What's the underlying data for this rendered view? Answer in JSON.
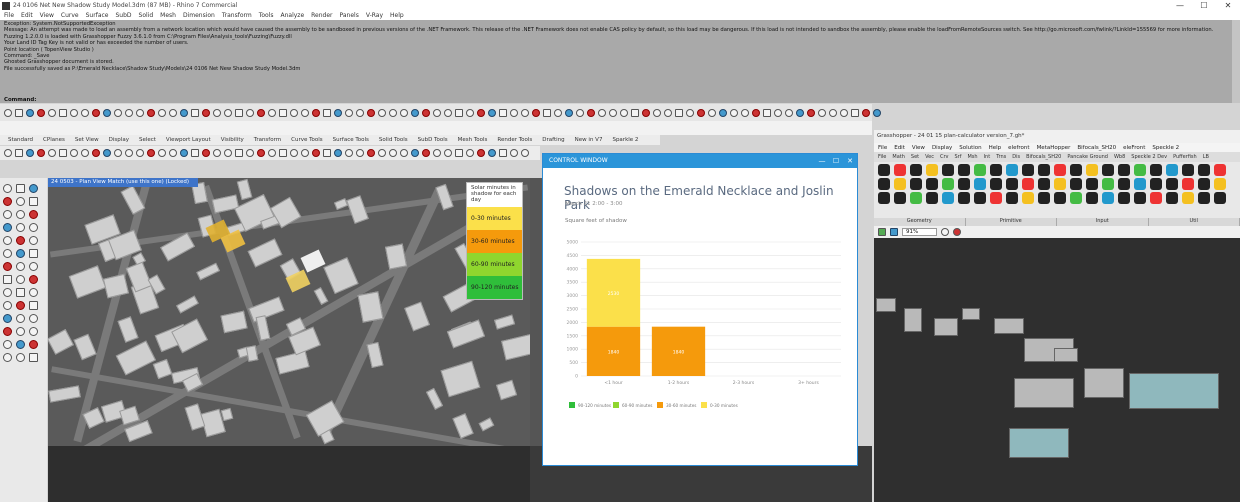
{
  "window": {
    "title": "24 0106 Net New Shadow Study Model.3dm (87 MB) - Rhino 7 Commercial",
    "controls": [
      "—",
      "☐",
      "✕"
    ]
  },
  "menubar": [
    "File",
    "Edit",
    "View",
    "Curve",
    "Surface",
    "SubD",
    "Solid",
    "Mesh",
    "Dimension",
    "Transform",
    "Tools",
    "Analyze",
    "Render",
    "Panels",
    "V-Ray",
    "Help"
  ],
  "command_history": [
    "Exception: System.NotSupportedException",
    "Message: An attempt was made to load an assembly from a network location which would have caused the assembly to be sandboxed in previous versions of the .NET Framework. This release of the .NET Framework does not enable CAS policy by default, so this load may be dangerous. If this load is not intended to sandbox the assembly, please enable the loadFromRemoteSources switch. See http://go.microsoft.com/fwlink/?LinkId=155569 for more information.",
    "",
    "Fuzzing 1.2.0.0 is loaded with Grasshopper Fuzzy 3.6.1.0 from C:\\Program Files\\Analysis_tools\\Fuzzing\\Fuzzy.dll",
    "Your Land ID Tag Key is not valid or has exceeded the number of users.",
    "Point location ( TopenView Studio )",
    "Command: _Save",
    "Ghosted Grasshopper document is stored.",
    "File successfully saved as P:\\Emerald Necklace\\Shadow Study\\Models\\24 0106 Net New Shadow Study Model.3dm"
  ],
  "command_prompt": "Command:",
  "toolbar_tabs": [
    "Standard",
    "CPlanes",
    "Set View",
    "Display",
    "Select",
    "Viewport Layout",
    "Visibility",
    "Transform",
    "Curve Tools",
    "Surface Tools",
    "Solid Tools",
    "SubD Tools",
    "Mesh Tools",
    "Render Tools",
    "Drafting",
    "New in V7",
    "Sparkle 2"
  ],
  "viewport": {
    "label": "24 0503 - Plan View Match (use this one) (Locked)"
  },
  "legend": {
    "header": "Solar minutes in shadow for each day",
    "items": [
      {
        "label": "0-30 minutes",
        "color": "#fbe04a"
      },
      {
        "label": "30-60 minutes",
        "color": "#f59a0c"
      },
      {
        "label": "60-90 minutes",
        "color": "#8fd62e"
      },
      {
        "label": "90-120 minutes",
        "color": "#2fbe3a"
      }
    ]
  },
  "control_window": {
    "title": "CONTROL WINDOW",
    "controls": [
      "—",
      "☐",
      "✕"
    ],
    "chart_title": "Shadows on the Emerald Necklace and Joslin Park",
    "chart_subtitle": "March 21 2:00 - 3:00",
    "y_label": "Square feet of shadow"
  },
  "chart_data": {
    "type": "bar",
    "stacked": true,
    "categories": [
      "<1 hour",
      "1-2 hours",
      "2-3 hours",
      "3+ hours"
    ],
    "ylim": [
      0,
      5000
    ],
    "ytick_labels": [
      "5000",
      "4500",
      "4000",
      "3500",
      "3000",
      "2500",
      "2000",
      "1500",
      "1000",
      "500",
      "0"
    ],
    "series": [
      {
        "name": "90-120 minutes",
        "color": "#2fbe3a",
        "values": [
          0,
          0,
          0,
          0
        ]
      },
      {
        "name": "60-90 minutes",
        "color": "#8fd62e",
        "values": [
          0,
          0,
          0,
          0
        ]
      },
      {
        "name": "30-60 minutes",
        "color": "#f59a0c",
        "values": [
          1840,
          1840,
          0,
          0
        ]
      },
      {
        "name": "0-30 minutes",
        "color": "#fbe04a",
        "values": [
          2530,
          0,
          0,
          0
        ]
      }
    ],
    "data_labels": [
      {
        "category": 0,
        "series": 2,
        "text": "1840"
      },
      {
        "category": 0,
        "series": 3,
        "text": "2530"
      },
      {
        "category": 1,
        "series": 2,
        "text": "1840"
      }
    ],
    "grid": true,
    "legend_position": "bottom-left"
  },
  "grasshopper": {
    "title": "Grasshopper - 24 01 15 plan-calculator version_7.gh*",
    "menu": [
      "File",
      "Edit",
      "View",
      "Display",
      "Solution",
      "Help",
      "elefront",
      "MetaHopper",
      "Bifocals_SH20",
      "eleFront",
      "Speckle 2"
    ],
    "tabs": [
      "File",
      "Math",
      "Set",
      "Vec",
      "Crv",
      "Srf",
      "Msh",
      "Int",
      "Trns",
      "Dis",
      "Bifocals_SH20",
      "Pancake Ground",
      "Wb8",
      "Speckle 2 Dev",
      "Pufferfish",
      "LB"
    ],
    "ribbon_groups": [
      "Geometry",
      "Primitive",
      "Input",
      "Util"
    ],
    "zoom": "91%"
  }
}
